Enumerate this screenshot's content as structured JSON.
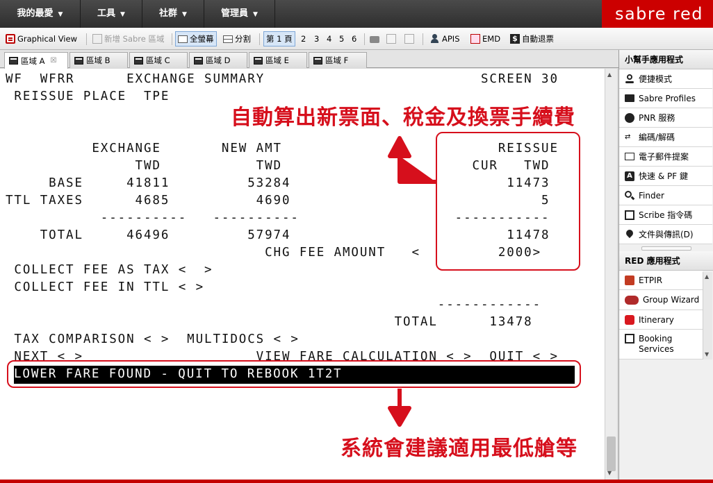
{
  "brand": "sabre red",
  "menu": [
    {
      "label": "我的最愛"
    },
    {
      "label": "工具"
    },
    {
      "label": "社群"
    },
    {
      "label": "管理員"
    }
  ],
  "toolbar": {
    "graphical_view": "Graphical View",
    "new_area": "新增 Sabre 區域",
    "full_screen": "全螢幕",
    "split": "分割",
    "page_label": "第 1 頁",
    "pages": [
      "2",
      "3",
      "4",
      "5",
      "6"
    ],
    "apis": "APIS",
    "emd": "EMD",
    "auto_refund": "自動退票"
  },
  "tabs": [
    {
      "label": "區域 A",
      "selected": true,
      "close": "☒"
    },
    {
      "label": "區域 B"
    },
    {
      "label": "區域 C"
    },
    {
      "label": "區域 D"
    },
    {
      "label": "區域 E"
    },
    {
      "label": "區域 F"
    }
  ],
  "terminal": {
    "lines": [
      "WF  WFRR      EXCHANGE SUMMARY                         SCREEN 30",
      " REISSUE PLACE  TPE",
      "",
      "",
      "          EXCHANGE       NEW AMT                         REISSUE",
      "               TWD           TWD                      CUR   TWD",
      "     BASE     41811         53284                         11473",
      "TTL TAXES      4685          4690                             5",
      "           ----------   ----------                  -----------",
      "    TOTAL     46496         57974                         11478",
      "                              CHG FEE AMOUNT   <         2000>",
      " COLLECT FEE AS TAX <  >",
      " COLLECT FEE IN TTL < >",
      "                                                  ------------",
      "                                             TOTAL      13478",
      " TAX COMPARISON < >  MULTIDOCS < >",
      " NEXT < >                    VIEW FARE CALCULATION < >  QUIT < >"
    ],
    "highlight_line": "LOWER FARE FOUND - QUIT TO REBOOK 1T2T"
  },
  "annotations": {
    "top": "自動算出新票面、稅金及換票手續費",
    "bottom": "系統會建議適用最低艙等"
  },
  "helper_panel": {
    "title": "小幫手應用程式",
    "items": [
      {
        "label": "便捷模式",
        "icon": "person-pin-icon"
      },
      {
        "label": "Sabre Profiles",
        "icon": "id-card-icon"
      },
      {
        "label": "PNR 服務",
        "icon": "user-circle-icon"
      },
      {
        "label": "編碼/解碼",
        "icon": "code-icon"
      },
      {
        "label": "電子郵件提案",
        "icon": "envelope-icon"
      },
      {
        "label": "快速 & PF 鍵",
        "icon": "key-icon"
      },
      {
        "label": "Finder",
        "icon": "magnifier-icon"
      },
      {
        "label": "Scribe 指令碼",
        "icon": "script-icon"
      },
      {
        "label": "文件與傳訊(D)",
        "icon": "location-pin-icon"
      }
    ]
  },
  "red_apps": {
    "title": "RED 應用程式",
    "items": [
      {
        "label": "ETPIR",
        "icon": "org-chart-icon"
      },
      {
        "label": "Group Wizard",
        "icon": "group-icon"
      },
      {
        "label": "Itinerary",
        "icon": "itinerary-icon"
      },
      {
        "label": "Booking Services",
        "icon": "booking-icon"
      }
    ]
  },
  "colors": {
    "brand_red": "#cc0000",
    "annotation_red": "#d60f1c",
    "menu_dark": "#3a3a3a"
  }
}
